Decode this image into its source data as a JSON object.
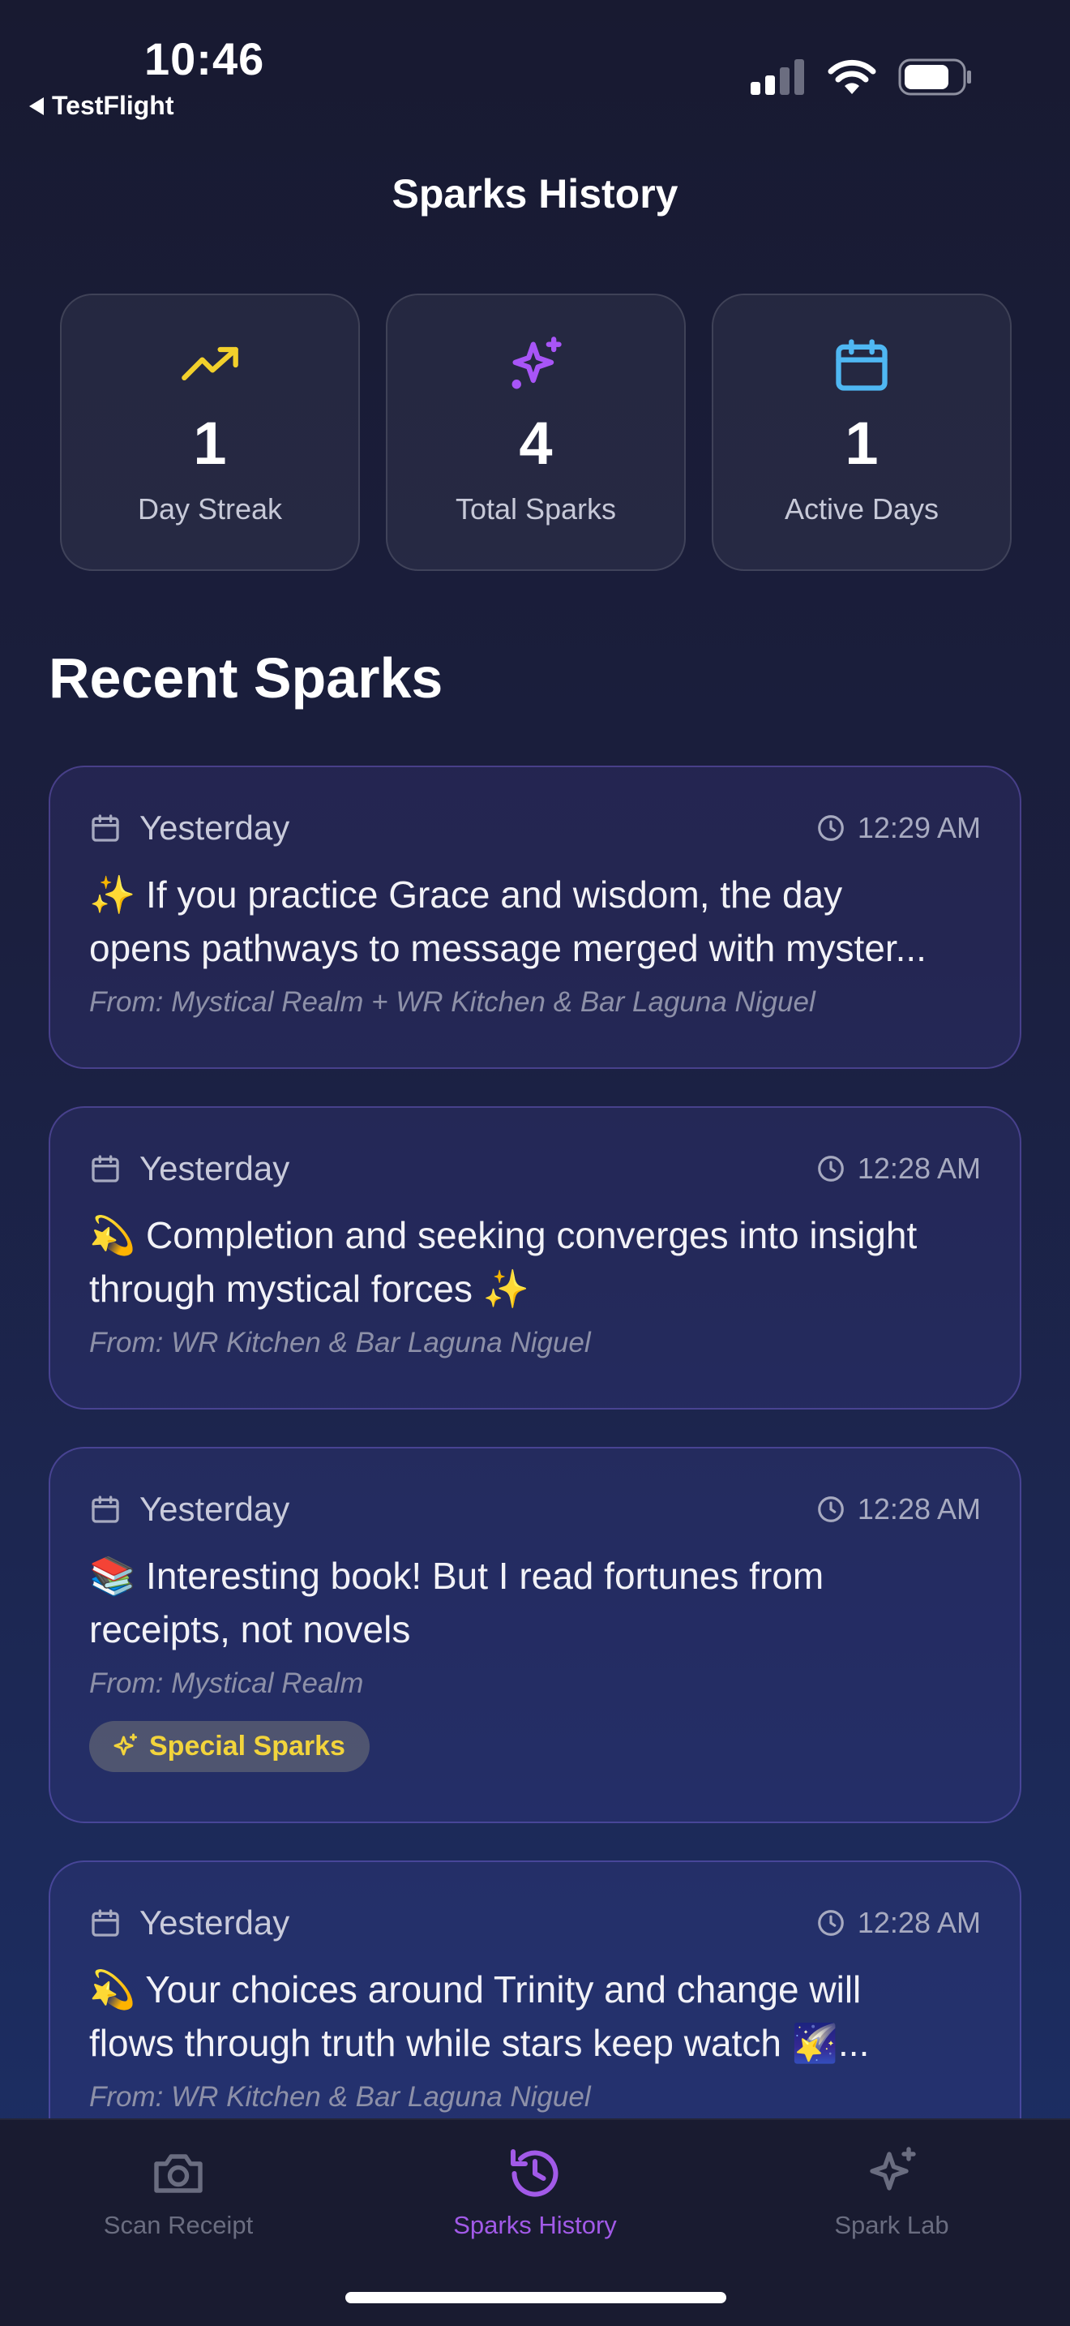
{
  "status_bar": {
    "time": "10:46",
    "back_app": "TestFlight"
  },
  "page_title": "Sparks History",
  "stats": [
    {
      "icon": "trending-up-icon",
      "value": "1",
      "label": "Day Streak",
      "color": "#f2d02b"
    },
    {
      "icon": "sparkles-icon",
      "value": "4",
      "label": "Total Sparks",
      "color": "#a855f7"
    },
    {
      "icon": "calendar-icon",
      "value": "1",
      "label": "Active Days",
      "color": "#4fb7f2"
    }
  ],
  "section_title": "Recent Sparks",
  "sparks": [
    {
      "date": "Yesterday",
      "time": "12:29 AM",
      "line1": "✨ If you practice Grace and wisdom, the day",
      "line2": "opens pathways to message merged with myster...",
      "from": "From: Mystical Realm + WR Kitchen & Bar Laguna Niguel"
    },
    {
      "date": "Yesterday",
      "time": "12:28 AM",
      "line1": "💫 Completion and seeking converges into insight",
      "line2": "through mystical forces ✨",
      "from": "From: WR Kitchen & Bar Laguna Niguel"
    },
    {
      "date": "Yesterday",
      "time": "12:28 AM",
      "line1": "📚 Interesting book! But I read fortunes from",
      "line2": "receipts, not novels",
      "from": "From: Mystical Realm",
      "badge": "Special Sparks"
    },
    {
      "date": "Yesterday",
      "time": "12:28 AM",
      "line1": "💫 Your choices around Trinity and change will",
      "line2": "flows through truth while stars keep watch 🌠...",
      "from": "From: WR Kitchen & Bar Laguna Niguel"
    }
  ],
  "tabs": [
    {
      "label": "Scan Receipt",
      "icon": "camera-icon",
      "active": false
    },
    {
      "label": "Sparks History",
      "icon": "history-icon",
      "active": true
    },
    {
      "label": "Spark Lab",
      "icon": "sparkles-icon",
      "active": false
    }
  ],
  "colors": {
    "accent": "#a25ae8",
    "badge_text": "#f2d43c"
  }
}
